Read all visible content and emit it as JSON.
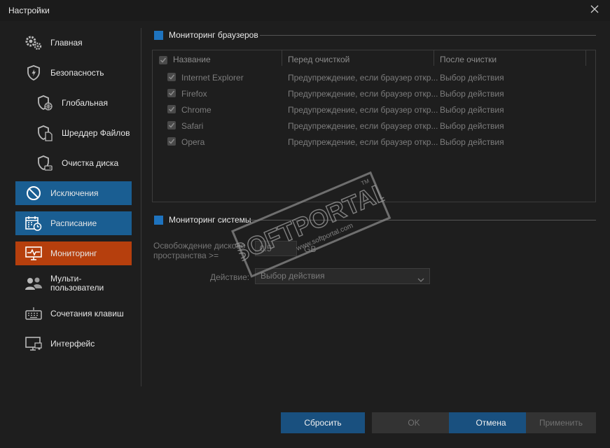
{
  "window": {
    "title": "Настройки"
  },
  "sidebar": {
    "items": [
      {
        "label": "Главная",
        "icon": "gears-icon"
      },
      {
        "label": "Безопасность",
        "icon": "shield-icon"
      },
      {
        "label": "Глобальная",
        "icon": "shield-globe-icon"
      },
      {
        "label": "Шреддер Файлов",
        "icon": "shield-file-icon"
      },
      {
        "label": "Очистка диска",
        "icon": "shield-disk-icon"
      },
      {
        "label": "Исключения",
        "icon": "prohibited-icon"
      },
      {
        "label": "Расписание",
        "icon": "calendar-clock-icon"
      },
      {
        "label": "Мониторинг",
        "icon": "monitor-pulse-icon"
      },
      {
        "label_line1": "Мульти-",
        "label_line2": "пользователи",
        "icon": "users-icon"
      },
      {
        "label": "Сочетания клавиш",
        "icon": "keyboard-icon"
      },
      {
        "label": "Интерфейс",
        "icon": "display-icon"
      }
    ]
  },
  "browser_monitoring": {
    "title": "Мониторинг браузеров",
    "columns": [
      "Название",
      "Перед очисткой",
      "После очистки"
    ],
    "rows": [
      {
        "name": "Internet Explorer",
        "before": "Предупреждение, если браузер откр...",
        "after": "Выбор действия"
      },
      {
        "name": "Firefox",
        "before": "Предупреждение, если браузер откр...",
        "after": "Выбор действия"
      },
      {
        "name": "Chrome",
        "before": "Предупреждение, если браузер откр...",
        "after": "Выбор действия"
      },
      {
        "name": "Safari",
        "before": "Предупреждение, если браузер откр...",
        "after": "Выбор действия"
      },
      {
        "name": "Opera",
        "before": "Предупреждение, если браузер откр...",
        "after": "Выбор действия"
      }
    ]
  },
  "system_monitoring": {
    "title": "Мониторинг системы",
    "free_space_label_line1": "Освобождение дисково",
    "free_space_label_line2": "пространства >=",
    "free_space_value": "0.5",
    "free_space_unit": "GB",
    "action_label": "Действие:",
    "action_value": "Выбор действия"
  },
  "buttons": {
    "reset": "Сбросить",
    "ok": "OK",
    "cancel": "Отмена",
    "apply": "Применить"
  },
  "watermark": {
    "brand": "SOFTPORTAL",
    "tm": "TM",
    "url": "www.softportal.com"
  },
  "colors": {
    "accent_blue": "#1a5e92",
    "accent_orange": "#b63f0d",
    "section_square": "#1e73be"
  }
}
